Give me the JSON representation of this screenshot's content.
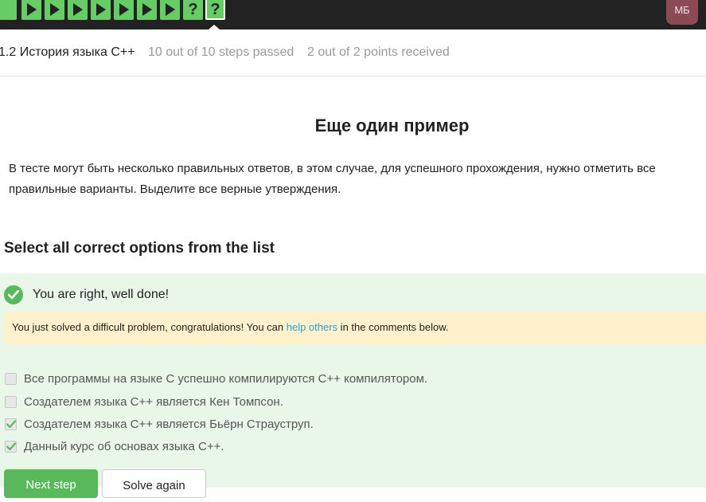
{
  "header": {
    "steps": [
      {
        "status": "passed",
        "type": "text",
        "icon": "square-icon"
      },
      {
        "status": "passed",
        "type": "video",
        "icon": "play-icon"
      },
      {
        "status": "passed",
        "type": "video",
        "icon": "play-icon"
      },
      {
        "status": "passed",
        "type": "video",
        "icon": "play-icon"
      },
      {
        "status": "passed",
        "type": "video",
        "icon": "play-icon"
      },
      {
        "status": "passed",
        "type": "video",
        "icon": "play-icon"
      },
      {
        "status": "passed",
        "type": "video",
        "icon": "play-icon"
      },
      {
        "status": "passed",
        "type": "video",
        "icon": "play-icon"
      },
      {
        "status": "passed",
        "type": "quiz",
        "icon": "question-icon",
        "glyph": "?"
      },
      {
        "status": "passed",
        "type": "quiz",
        "icon": "question-icon",
        "glyph": "?",
        "current": true
      }
    ],
    "user_initials": "МБ",
    "colors": {
      "bar": "#222222",
      "step_passed": "#66cc66",
      "avatar": "#8b4a54"
    }
  },
  "lesson": {
    "title": "1.2 История языка C++",
    "steps_passed": "10 out of 10 steps passed",
    "points": "2 out of 2 points  received"
  },
  "content": {
    "heading": "Еще один пример",
    "description": "В тесте могут быть несколько правильных ответов, в этом случае, для успешного прохождения, нужно отметить все правильные варианты. Выделите все верные утверждения."
  },
  "quiz": {
    "title": "Select all correct options from the list",
    "feedback": "You are right, well done!",
    "hint_prefix": "You just solved a difficult problem, congratulations! You can ",
    "hint_link": "help others",
    "hint_suffix": " in the comments below.",
    "options": [
      {
        "text": "Все программы на языке C успешно компилируются C++ компилятором.",
        "checked": false
      },
      {
        "text": "Создателем языка C++ является Кен Томпсон.",
        "checked": false
      },
      {
        "text": "Создателем языка C++ является Бьёрн Страуструп.",
        "checked": true
      },
      {
        "text": "Данный курс об основах языка C++.",
        "checked": true
      }
    ],
    "next_button": "Next step",
    "solve_again_button": "Solve again",
    "colors": {
      "success_bg": "#e9f7e9",
      "hint_bg": "#fff1cc",
      "accent_green": "#59b85c",
      "link": "#2a9fd6"
    }
  }
}
